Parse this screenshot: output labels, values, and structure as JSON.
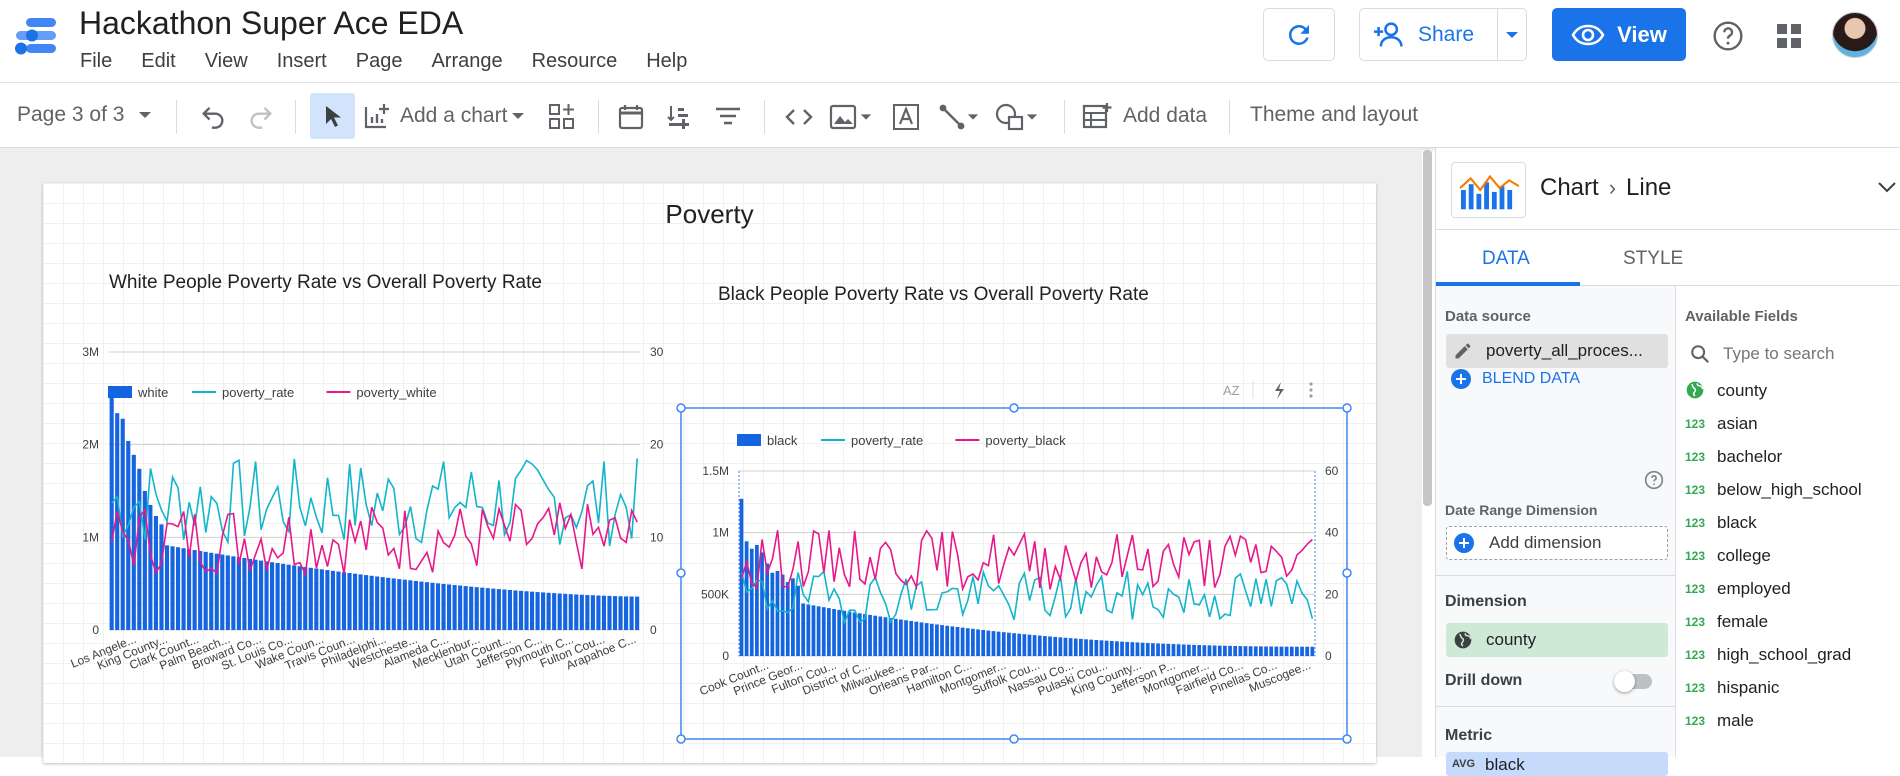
{
  "header": {
    "title": "Hackathon Super Ace EDA",
    "menu": [
      "File",
      "Edit",
      "View",
      "Insert",
      "Page",
      "Arrange",
      "Resource",
      "Help"
    ],
    "share_label": "Share",
    "view_label": "View"
  },
  "toolbar": {
    "page_indicator": "Page 3 of 3",
    "add_chart": "Add a chart",
    "add_data": "Add data",
    "theme_layout": "Theme and layout"
  },
  "report": {
    "title": "Poverty",
    "chart1_title": "White People Poverty Rate vs Overall Poverty Rate",
    "chart2_title": "Black People Poverty Rate vs Overall Poverty Rate"
  },
  "panel": {
    "chart_label": "Chart",
    "chart_type": "Line",
    "tab_data": "DATA",
    "tab_style": "STYLE",
    "data_source_label": "Data source",
    "data_source_value": "poverty_all_proces...",
    "blend_data": "BLEND DATA",
    "date_range_label": "Date Range Dimension",
    "add_dimension": "Add dimension",
    "dimension_label": "Dimension",
    "dimension_value": "county",
    "drill_down": "Drill down",
    "metric_label": "Metric",
    "metric_agg": "AVG",
    "metric_value": "black",
    "available_fields": "Available Fields",
    "search_placeholder": "Type to search",
    "fields": [
      {
        "type": "geo",
        "name": "county"
      },
      {
        "type": "123",
        "name": "asian"
      },
      {
        "type": "123",
        "name": "bachelor"
      },
      {
        "type": "123",
        "name": "below_high_school"
      },
      {
        "type": "123",
        "name": "black"
      },
      {
        "type": "123",
        "name": "college"
      },
      {
        "type": "123",
        "name": "employed"
      },
      {
        "type": "123",
        "name": "female"
      },
      {
        "type": "123",
        "name": "high_school_grad"
      },
      {
        "type": "123",
        "name": "hispanic"
      },
      {
        "type": "123",
        "name": "male"
      }
    ]
  },
  "colors": {
    "accent": "#1a73e8",
    "bar": "#1565e0",
    "line_rate": "#12b5cb",
    "line_group": "#e8178a"
  },
  "chart_data": [
    {
      "type": "bar",
      "legend": [
        "white",
        "poverty_rate",
        "poverty_white"
      ],
      "y_left_ticks": [
        "0",
        "1M",
        "2M",
        "3M"
      ],
      "y_right_ticks": [
        "0",
        "10",
        "20",
        "30"
      ],
      "ylim_left": [
        0,
        3000000
      ],
      "ylim_right": [
        0,
        30
      ],
      "x_tick_labels": [
        "Los Angele...",
        "King County...",
        "Clark Count...",
        "Palm Beach...",
        "Broward Co...",
        "St. Louis Co...",
        "Wake Coun...",
        "Travis Coun...",
        "Philadelphi...",
        "Westcheste...",
        "Alameda C...",
        "Mecklenbur...",
        "Utah Count...",
        "Jefferson C...",
        "Plymouth C...",
        "Fulton Cou...",
        "Arapahoe C..."
      ]
    },
    {
      "type": "bar",
      "legend": [
        "black",
        "poverty_rate",
        "poverty_black"
      ],
      "y_left_ticks": [
        "0",
        "500K",
        "1M",
        "1.5M"
      ],
      "y_right_ticks": [
        "0",
        "20",
        "40",
        "60"
      ],
      "ylim_left": [
        0,
        1500000
      ],
      "ylim_right": [
        0,
        60
      ],
      "x_tick_labels": [
        "Cook Count...",
        "Prince Geor...",
        "Fulton Cou...",
        "District of C...",
        "Milwaukee...",
        "Orleans Par...",
        "Hamilton C...",
        "Montgomer...",
        "Suffolk Cou...",
        "Nassau Co...",
        "Pulaski Cou...",
        "King County...",
        "Jefferson P...",
        "Montgomer...",
        "Fairfield Co...",
        "Pinellas Co...",
        "Muscogee..."
      ]
    }
  ]
}
